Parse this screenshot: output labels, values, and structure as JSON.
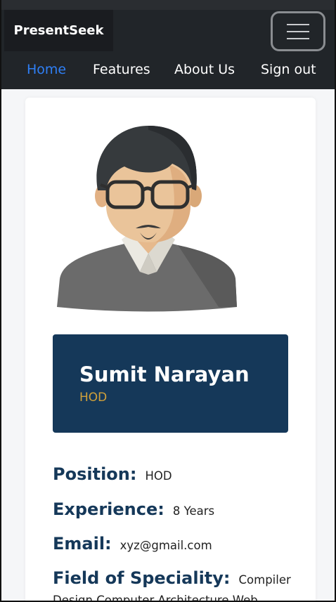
{
  "navbar": {
    "brand": "PresentSeek",
    "toggler_icon": "hamburger-icon",
    "links": [
      {
        "label": "Home",
        "active": true
      },
      {
        "label": "Features",
        "active": false
      },
      {
        "label": "About Us",
        "active": false
      },
      {
        "label": "Sign out",
        "active": false
      }
    ]
  },
  "profile": {
    "avatar_icon": "user-avatar-illustration",
    "name": "Sumit Narayan",
    "role": "HOD",
    "fields": [
      {
        "label": "Position:",
        "value": "HOD"
      },
      {
        "label": "Experience:",
        "value": "8 Years"
      },
      {
        "label": "Email:",
        "value": "xyz@gmail.com"
      },
      {
        "label": "Field of Speciality:",
        "value": "Compiler Design,Computer Architecture,Web"
      }
    ]
  },
  "colors": {
    "navbar_bg": "#212529",
    "active_link": "#2f7ff5",
    "name_box_bg": "#153859",
    "role_color": "#d1a13a",
    "label_color": "#153859"
  }
}
